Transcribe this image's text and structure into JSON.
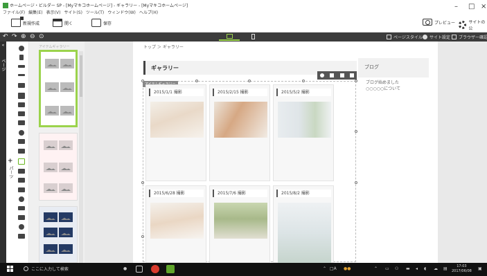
{
  "window": {
    "title": "ホームページ・ビルダー SP - [Myマキコホームページ] - ギャラリー - [Myマキコホームページ]",
    "menu": [
      "ファイル(F)",
      "編集(E)",
      "表示(V)",
      "サイト(S)",
      "ツール(T)",
      "ウィンドウ(W)",
      "ヘルプ(H)"
    ],
    "min_label": "–",
    "restore_label": "□",
    "close_label": "×"
  },
  "toolbar": {
    "new_label": "新規作成",
    "open_label": "開く",
    "save_label": "保存",
    "preview_label": "プレビュー",
    "site_label": "サイトの公"
  },
  "darkbar": {
    "undo": "↶",
    "redo": "↷",
    "zoom_in": "⊕",
    "zoom_out": "⊖",
    "zoom_fit": "⊙",
    "page_style": "ページスタイル",
    "site_settings": "サイト設定",
    "browser_check": "ブラウザー確認"
  },
  "left_strip": {
    "page_text": "ページ",
    "parts_text": "パーツ",
    "plus": "+",
    "chevron": "«"
  },
  "thumbs": {
    "caption": "アイテムギャラリー"
  },
  "page": {
    "breadcrumb": "トップ ＞ ギャラリー",
    "heading": "ギャラリー",
    "gallery_tag": "アイテムギャラリー",
    "cards": [
      {
        "date": "2015/1/1 撮影"
      },
      {
        "date": "2015/2/15 撮影"
      },
      {
        "date": "2015/5/2 撮影"
      },
      {
        "date": "2015/6/28 撮影"
      },
      {
        "date": "2015/7/6 撮影"
      },
      {
        "date": "2015/8/2 撮影"
      }
    ]
  },
  "blog": {
    "title": "ブログ",
    "line1": "ブログ始めました",
    "line2": "○○○○○について"
  },
  "taskbar": {
    "search": "ここに入力して検索",
    "time": "17:03",
    "date": "2017/06/08"
  },
  "colors": {
    "accent_green": "#9bd34c",
    "dark_bar": "#3c3c3c",
    "taskbar": "#111111"
  }
}
